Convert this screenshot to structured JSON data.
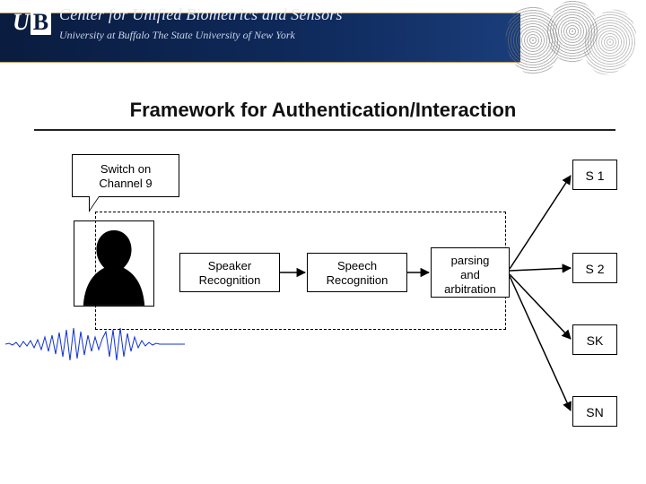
{
  "header": {
    "logo_u": "U",
    "logo_b": "B",
    "title": "Center for Unified Biometrics and Sensors",
    "subtitle": "University at Buffalo   The State University of New York"
  },
  "slide_title": "Framework for Authentication/Interaction",
  "bubble_line1": "Switch on",
  "bubble_line2": "Channel 9",
  "pipeline": {
    "speaker": "Speaker\nRecognition",
    "speech": "Speech\nRecognition",
    "parser": "parsing\nand\narbitration"
  },
  "outputs": {
    "s1": "S 1",
    "s2": "S 2",
    "sk": "SK",
    "sn": "SN"
  }
}
